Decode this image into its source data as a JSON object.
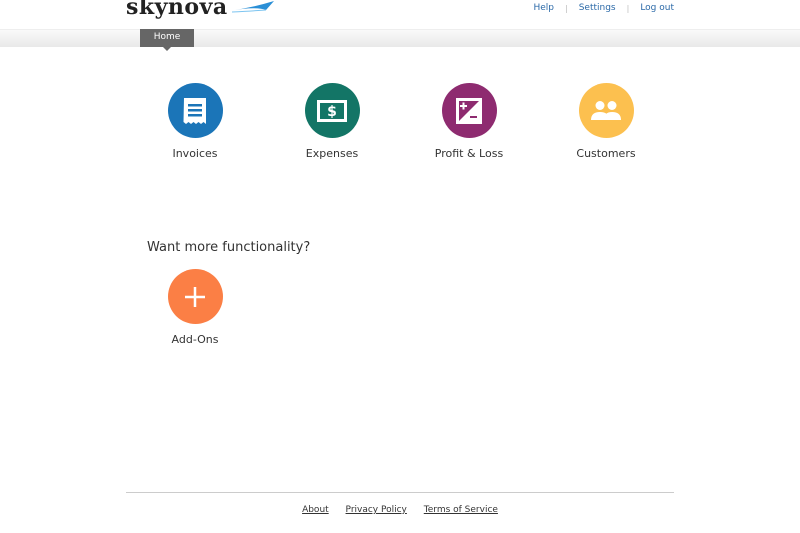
{
  "header": {
    "logo": "skynova",
    "links": [
      {
        "label": "Help"
      },
      {
        "label": "Settings"
      },
      {
        "label": "Log out"
      }
    ]
  },
  "nav": {
    "home": "Home"
  },
  "tiles": [
    {
      "label": "Invoices",
      "color": "#1b75b8",
      "icon": "receipt-icon"
    },
    {
      "label": "Expenses",
      "color": "#137566",
      "icon": "dollar-bill-icon"
    },
    {
      "label": "Profit & Loss",
      "color": "#8e2b70",
      "icon": "plus-minus-icon"
    },
    {
      "label": "Customers",
      "color": "#fcc04f",
      "icon": "people-icon"
    }
  ],
  "addons": {
    "heading": "Want more functionality?",
    "label": "Add-Ons",
    "color": "#fb7f45"
  },
  "footer": {
    "links": [
      {
        "label": "About"
      },
      {
        "label": "Privacy Policy"
      },
      {
        "label": "Terms of Service"
      }
    ]
  }
}
